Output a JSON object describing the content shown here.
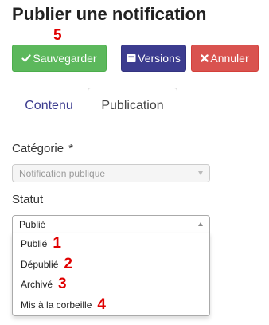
{
  "page": {
    "title": "Publier une notification"
  },
  "annotations": {
    "toolbar_marker": "5"
  },
  "toolbar": {
    "save_label": "Sauvegarder",
    "versions_label": "Versions",
    "cancel_label": "Annuler",
    "colors": {
      "save": "#5cb85c",
      "versions": "#3c3c8f",
      "cancel": "#d9534f"
    }
  },
  "tabs": [
    {
      "label": "Contenu",
      "active": false
    },
    {
      "label": "Publication",
      "active": true
    }
  ],
  "fields": {
    "category": {
      "label": "Catégorie",
      "required_mark": "*",
      "value": "Notification publique",
      "disabled": true
    },
    "status": {
      "label": "Statut",
      "value": "Publié",
      "open": true,
      "options": [
        {
          "label": "Publié",
          "marker": "1"
        },
        {
          "label": "Dépublié",
          "marker": "2"
        },
        {
          "label": "Archivé",
          "marker": "3"
        },
        {
          "label": "Mis à la corbeille",
          "marker": "4"
        }
      ]
    }
  },
  "icons": {
    "save": "check-icon",
    "versions": "versions-icon",
    "cancel": "times-icon"
  }
}
